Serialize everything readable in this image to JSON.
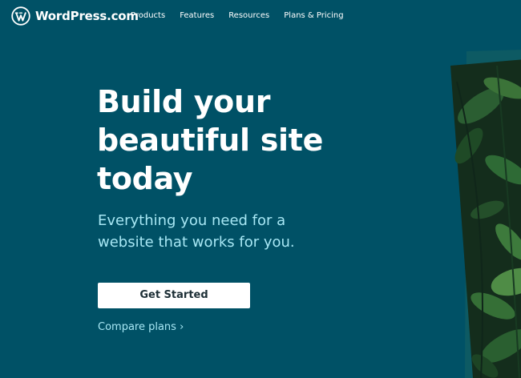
{
  "brand": {
    "name": "WordPress.com",
    "logo_icon": "wordpress-logo-icon"
  },
  "nav": {
    "items": [
      {
        "label": "Products"
      },
      {
        "label": "Features"
      },
      {
        "label": "Resources"
      },
      {
        "label": "Plans & Pricing"
      }
    ]
  },
  "hero": {
    "title": "Build your beautiful site today",
    "subtitle": "Everything you need for a website that works for you.",
    "cta_label": "Get Started",
    "secondary_link": "Compare plans ›"
  },
  "colors": {
    "background": "#005166",
    "text": "#ffffff",
    "accent_light": "#a7e7f4",
    "button_bg": "#ffffff",
    "button_text": "#1d2f36"
  }
}
